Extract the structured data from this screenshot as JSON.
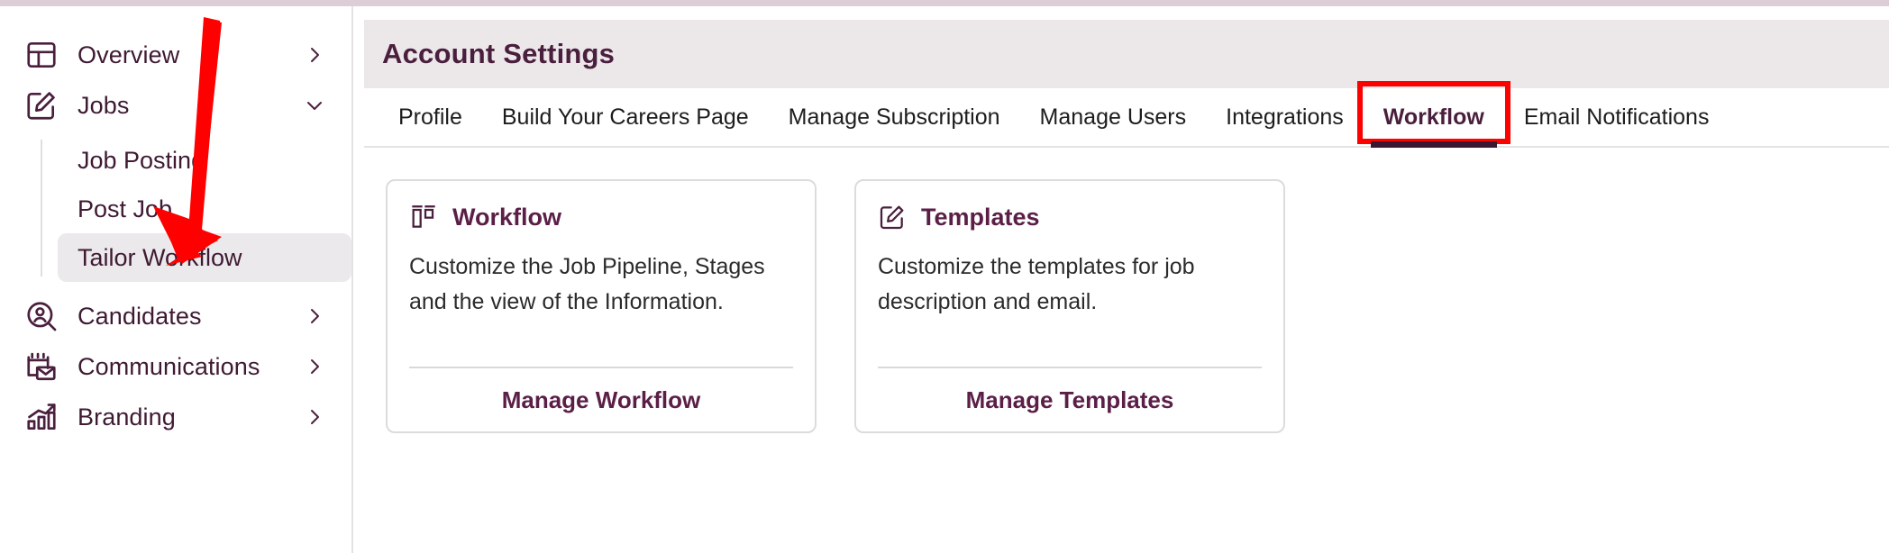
{
  "sidebar": {
    "items": [
      {
        "label": "Overview",
        "icon": "layout-icon",
        "chevron": "chevron-right-icon"
      },
      {
        "label": "Jobs",
        "icon": "edit-square-icon",
        "chevron": "chevron-down-icon"
      },
      {
        "label": "Candidates",
        "icon": "user-search-icon",
        "chevron": "chevron-right-icon"
      },
      {
        "label": "Communications",
        "icon": "mail-calendar-icon",
        "chevron": "chevron-right-icon"
      },
      {
        "label": "Branding",
        "icon": "bar-chart-icon",
        "chevron": "chevron-right-icon"
      }
    ],
    "jobs_subitems": [
      {
        "label": "Job Posting",
        "active": false
      },
      {
        "label": "Post Job",
        "active": false
      },
      {
        "label": "Tailor Workflow",
        "active": true
      }
    ]
  },
  "header": {
    "title": "Account Settings"
  },
  "tabs": [
    {
      "label": "Profile",
      "active": false
    },
    {
      "label": "Build Your Careers Page",
      "active": false
    },
    {
      "label": "Manage Subscription",
      "active": false
    },
    {
      "label": "Manage Users",
      "active": false
    },
    {
      "label": "Integrations",
      "active": false
    },
    {
      "label": "Workflow",
      "active": true
    },
    {
      "label": "Email Notifications",
      "active": false
    }
  ],
  "cards": [
    {
      "icon": "workflow-columns-icon",
      "title": "Workflow",
      "description": "Customize the Job Pipeline, Stages and the view of the Information.",
      "action": "Manage Workflow"
    },
    {
      "icon": "edit-square-icon",
      "title": "Templates",
      "description": "Customize the templates for job description and email.",
      "action": "Manage Templates"
    }
  ],
  "annotations": {
    "arrow_color": "#ff0000",
    "highlight_box_color": "#ff0000",
    "arrow_target": "Tailor Workflow",
    "highlight_target": "Workflow"
  },
  "colors": {
    "brand_purple": "#4a1f3d",
    "banner_bg": "#ece8ea",
    "top_strip": "#ddcdd7",
    "active_underline": "#3b1630",
    "sidebar_active_bg": "#ebe9eb"
  }
}
